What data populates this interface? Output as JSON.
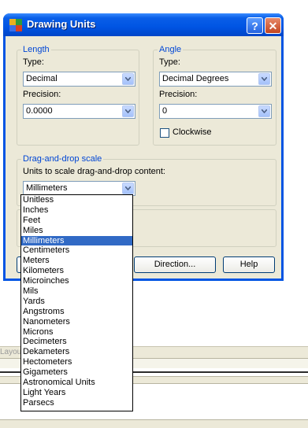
{
  "background": {
    "tab_label": "Layou"
  },
  "dialog": {
    "title": "Drawing Units",
    "help_glyph": "?",
    "close_glyph": "✕",
    "length": {
      "group_label": "Length",
      "type_label": "Type:",
      "type_value": "Decimal",
      "precision_label": "Precision:",
      "precision_value": "0.0000"
    },
    "angle": {
      "group_label": "Angle",
      "type_label": "Type:",
      "type_value": "Decimal Degrees",
      "precision_label": "Precision:",
      "precision_value": "0",
      "clockwise_label": "Clockwise",
      "clockwise_checked": false
    },
    "scale": {
      "group_label": "Drag-and-drop scale",
      "units_label": "Units to scale drag-and-drop content:",
      "units_value": "Millimeters"
    },
    "buttons": {
      "direction": "Direction...",
      "help": "Help"
    }
  },
  "units_dropdown": {
    "selected": "Millimeters",
    "options": [
      "Unitless",
      "Inches",
      "Feet",
      "Miles",
      "Millimeters",
      "Centimeters",
      "Meters",
      "Kilometers",
      "Microinches",
      "Mils",
      "Yards",
      "Angstroms",
      "Nanometers",
      "Microns",
      "Decimeters",
      "Dekameters",
      "Hectometers",
      "Gigameters",
      "Astronomical Units",
      "Light Years",
      "Parsecs"
    ]
  },
  "colors": {
    "title_bar": "#0054e3",
    "dialog_face": "#ece9d8",
    "group_title": "#0046d5",
    "selection": "#316ac5"
  }
}
